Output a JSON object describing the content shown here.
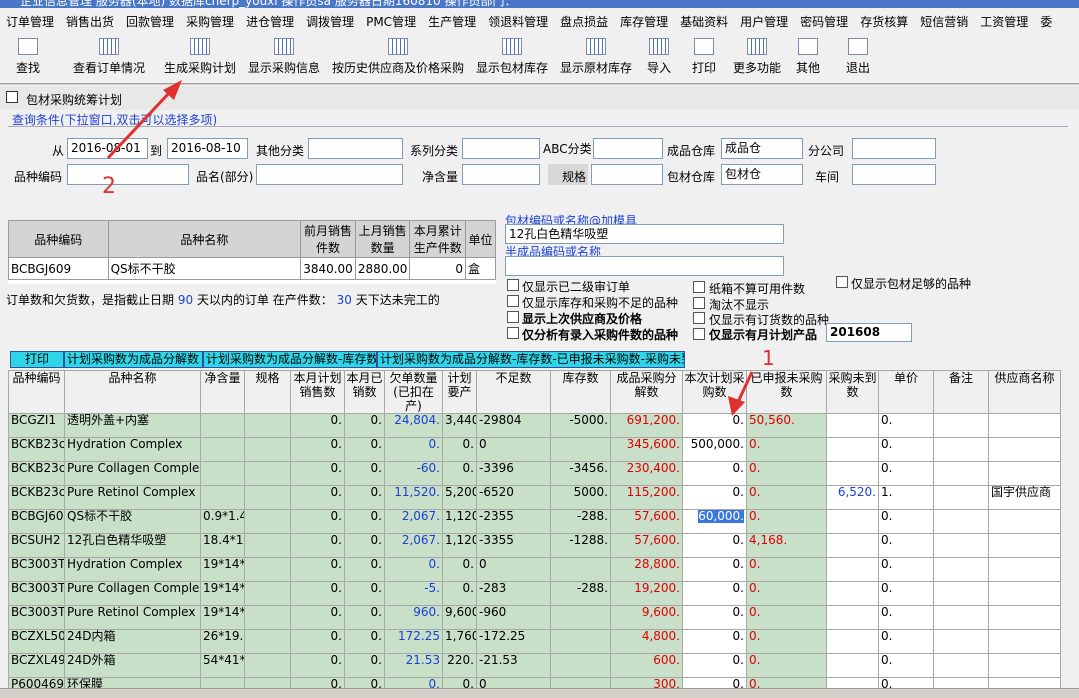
{
  "window": {
    "title": "企业信息管理   服务器(本地)  数据库cherp_youxi  操作员sa  服务器日期160810  操作员部门："
  },
  "menu": [
    "订单管理",
    "销售出货",
    "回款管理",
    "采购管理",
    "进仓管理",
    "调拨管理",
    "PMC管理",
    "生产管理",
    "领退料管理",
    "盘点损益",
    "库存管理",
    "基础资料",
    "用户管理",
    "密码管理",
    "存货核算",
    "短信营销",
    "工资管理",
    "委"
  ],
  "toolbar": [
    {
      "label": "查找",
      "icon": "binoculars-icon"
    },
    {
      "label": "查看订单情况",
      "icon": "grid-icon"
    },
    {
      "label": "生成采购计划",
      "icon": "grid-icon"
    },
    {
      "label": "显示采购信息",
      "icon": "grid-icon"
    },
    {
      "label": "按历史供应商及价格采购",
      "icon": "grid-icon"
    },
    {
      "label": "显示包材库存",
      "icon": "grid-icon"
    },
    {
      "label": "显示原材库存",
      "icon": "grid-icon"
    },
    {
      "label": "导入",
      "icon": "grid-icon"
    },
    {
      "label": "打印",
      "icon": "printer-icon"
    },
    {
      "label": "更多功能",
      "icon": "grid-icon"
    },
    {
      "label": "其他",
      "icon": "tools-icon"
    },
    {
      "label": "退出",
      "icon": "exit-icon"
    }
  ],
  "form": {
    "title": "包材采购统筹计划",
    "query_hint": "查询条件(下拉窗口,双击可以选择多项)",
    "from_label": "从",
    "from_value": "2016-08-01",
    "to_label": "到",
    "to_value": "2016-08-10",
    "other_cat_label": "其他分类",
    "series_label": "系列分类",
    "abc_label": "ABC分类",
    "finished_wh_label": "成品仓库",
    "finished_wh_value": "成品仓",
    "branch_label": "分公司",
    "code_label": "品种编码",
    "name_label": "品名(部分)",
    "net_label": "净含量",
    "spec_label": "规格",
    "pack_wh_label": "包材仓库",
    "pack_wh_value": "包材仓",
    "workshop_label": "车间"
  },
  "summary": {
    "headers": [
      "品种编码",
      "品种名称",
      "前月销售件数",
      "上月销售数量",
      "本月累计生产件数",
      "单位"
    ],
    "row": [
      "BCBGJ609",
      "QS标不干胶",
      "3840.00",
      "2880.00",
      "0",
      "盒"
    ]
  },
  "side": {
    "link1": "包材编码或名称@加模具",
    "search1": "12孔白色精华吸塑",
    "link2": "半成品编码或名称",
    "search2": ""
  },
  "note": {
    "prefix": "订单数和欠货数，是指截止日期",
    "days": "90",
    "mid": "天以内的订单  在产件数：",
    "prod_days": "30",
    "suffix": "天下达未完工的"
  },
  "options": [
    "仅显示已二级审订单",
    "仅显示库存和采购不足的品种",
    "显示上次供应商及价格",
    "仅分析有录入采购件数的品种",
    "纸箱不算可用件数",
    "淘汰不显示",
    "仅显示有订货数的品种",
    "仅显示有月计划产品",
    "仅显示包材足够的品种"
  ],
  "month_value": "201608",
  "actionbar": [
    "打印",
    "计划采购数为成品分解数",
    "计划采购数为成品分解数-库存数",
    "计划采购数为成品分解数-库存数-已申报未采购数-采购未到"
  ],
  "grid": {
    "headers": [
      "品种编码",
      "品种名称",
      "净含量",
      "规格",
      "本月计划销售数",
      "本月已销数",
      "欠单数量(已扣在产)",
      "计划要产",
      "不足数",
      "库存数",
      "成品采购分解数",
      "本次计划采购数",
      "已申报未采购数",
      "采购未到数",
      "单价",
      "备注",
      "供应商名称"
    ],
    "rows": [
      [
        "BCGZI1",
        "透明外盖+内塞",
        "",
        "",
        "0.",
        "0.",
        "24,804.",
        "3,440.",
        "-29804",
        "-5000.",
        "691,200.",
        "0.",
        "50,560.",
        "",
        "0.",
        "",
        ""
      ],
      [
        "BCKB23c",
        "Hydration Complex",
        "",
        "",
        "0.",
        "0.",
        "0.",
        "0.",
        "0",
        "",
        "345,600.",
        "500,000.",
        "0.",
        "",
        "0.",
        "",
        ""
      ],
      [
        "BCKB23c",
        "Pure Collagen Complex",
        "",
        "",
        "0.",
        "0.",
        "-60.",
        "0.",
        "-3396",
        "-3456.",
        "230,400.",
        "0.",
        "0.",
        "",
        "0.",
        "",
        ""
      ],
      [
        "BCKB23c",
        "Pure Retinol Complex",
        "",
        "",
        "0.",
        "0.",
        "11,520.",
        "5,200.",
        "-6520",
        "5000.",
        "115,200.",
        "0.",
        "0.",
        "6,520.",
        "1.",
        "",
        "国宇供应商"
      ],
      [
        "BCBGJ60",
        "QS标不干胶",
        "0.9*1.4",
        "",
        "0.",
        "0.",
        "2,067.",
        "1,120.",
        "-2355",
        "-288.",
        "57,600.",
        "60,000.",
        "0.",
        "",
        "0.",
        "",
        ""
      ],
      [
        "BCSUH2",
        "12孔白色精华吸塑",
        "18.4*13.",
        "",
        "0.",
        "0.",
        "2,067.",
        "1,120.",
        "-3355",
        "-1288.",
        "57,600.",
        "0.",
        "4,168.",
        "",
        "0.",
        "",
        ""
      ],
      [
        "BC3003TI",
        "Hydration Complex",
        "19*14*2",
        "",
        "0.",
        "0.",
        "0.",
        "0.",
        "0",
        "",
        "28,800.",
        "0.",
        "0.",
        "",
        "0.",
        "",
        ""
      ],
      [
        "BC3003TI",
        "Pure Collagen Complex",
        "19*14*2",
        "",
        "0.",
        "0.",
        "-5.",
        "0.",
        "-283",
        "-288.",
        "19,200.",
        "0.",
        "0.",
        "",
        "0.",
        "",
        ""
      ],
      [
        "BC3003TI",
        "Pure Retinol Complex",
        "19*14*2",
        "",
        "0.",
        "0.",
        "960.",
        "9,600.",
        "-960",
        "",
        "9,600.",
        "0.",
        "0.",
        "",
        "0.",
        "",
        ""
      ],
      [
        "BCZXL50",
        "24D内箱",
        "26*19.8",
        "",
        "0.",
        "0.",
        "172.25",
        "1,760.",
        "-172.25",
        "",
        "4,800.",
        "0.",
        "0.",
        "",
        "0.",
        "",
        ""
      ],
      [
        "BCZXL49",
        "24D外箱",
        "54*41*3",
        "",
        "0.",
        "0.",
        "21.53",
        "220.",
        "-21.53",
        "",
        "600.",
        "0.",
        "0.",
        "",
        "0.",
        "",
        ""
      ],
      [
        "P600469",
        "环保膜",
        "",
        "",
        "0.",
        "0.",
        "0.",
        "0.",
        "0",
        "",
        "300.",
        "0.",
        "0.",
        "",
        "0.",
        "",
        ""
      ]
    ]
  },
  "annotations": {
    "marker1": "1",
    "marker2": "2"
  },
  "colors": {
    "accent_red": "#e03030",
    "grid_green": "#c8dfc8",
    "bar_cyan": "#2fd6e8"
  }
}
